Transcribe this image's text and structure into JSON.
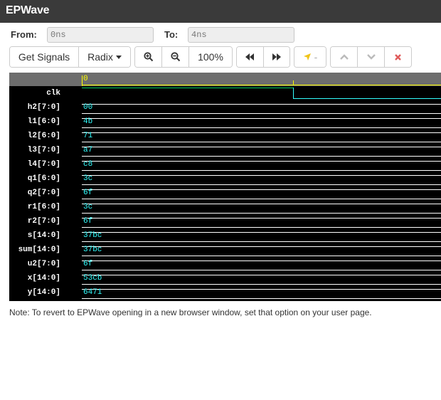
{
  "app": {
    "title": "EPWave"
  },
  "range": {
    "from_label": "From:",
    "from_value": "0ns",
    "to_label": "To:",
    "to_value": "4ns"
  },
  "toolbar": {
    "get_signals": "Get Signals",
    "radix": "Radix",
    "zoom_level": "100%",
    "cursor_label": "-"
  },
  "ruler": {
    "start_label": "0"
  },
  "signals": [
    {
      "name": "clk",
      "value": ""
    },
    {
      "name": "h2[7:0]",
      "value": "00"
    },
    {
      "name": "l1[6:0]",
      "value": "4b"
    },
    {
      "name": "l2[6:0]",
      "value": "71"
    },
    {
      "name": "l3[7:0]",
      "value": "a7"
    },
    {
      "name": "l4[7:0]",
      "value": "c8"
    },
    {
      "name": "q1[6:0]",
      "value": "3c"
    },
    {
      "name": "q2[7:0]",
      "value": "6f"
    },
    {
      "name": "r1[6:0]",
      "value": "3c"
    },
    {
      "name": "r2[7:0]",
      "value": "6f"
    },
    {
      "name": "s[14:0]",
      "value": "37bc"
    },
    {
      "name": "sum[14:0]",
      "value": "37bc"
    },
    {
      "name": "u2[7:0]",
      "value": "6f"
    },
    {
      "name": "x[14:0]",
      "value": "53cb"
    },
    {
      "name": "y[14:0]",
      "value": "6471"
    }
  ],
  "note": "Note: To revert to EPWave opening in a new browser window, set that option on your user page.",
  "colors": {
    "titlebar": "#3a3a3a",
    "wave_bg": "#000000",
    "value_text": "#33ffff",
    "ruler_accent": "#ffff00",
    "delete_red": "#e05a5a",
    "cursor_yellow": "#f0c419"
  }
}
